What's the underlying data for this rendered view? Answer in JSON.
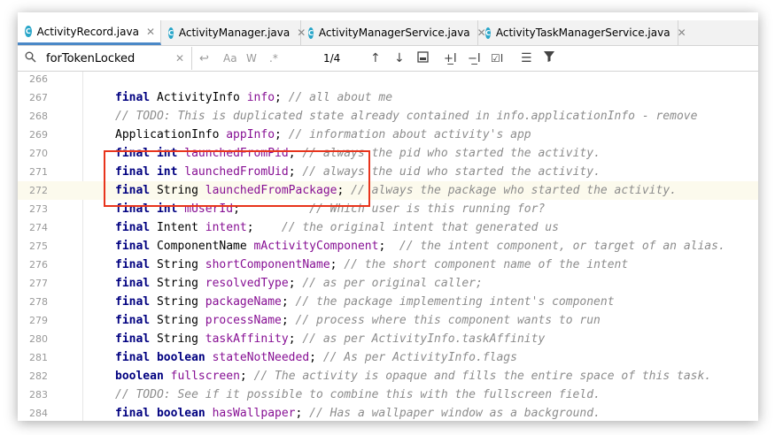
{
  "tabs": [
    {
      "label": "ActivityRecord.java",
      "active": true
    },
    {
      "label": "ActivityManager.java",
      "active": false
    },
    {
      "label": "ActivityManagerService.java",
      "active": false
    },
    {
      "label": "ActivityTaskManagerService.java",
      "active": false
    }
  ],
  "search": {
    "query": "forTokenLocked",
    "match_count": "1/4",
    "case_label": "Aa",
    "words_label": "W",
    "regex_label": ".*"
  },
  "editor": {
    "current_line": "272",
    "lines": [
      {
        "n": "266",
        "segs": []
      },
      {
        "n": "267",
        "segs": [
          [
            "kw",
            "final "
          ],
          [
            "t",
            "ActivityInfo "
          ],
          [
            "fld",
            "info"
          ],
          [
            "t",
            "; "
          ],
          [
            "cmt",
            "// all about me"
          ]
        ]
      },
      {
        "n": "268",
        "segs": [
          [
            "cmt",
            "// TODO: This is duplicated state already contained in info.applicationInfo - remove"
          ]
        ]
      },
      {
        "n": "269",
        "segs": [
          [
            "t",
            "ApplicationInfo "
          ],
          [
            "fld",
            "appInfo"
          ],
          [
            "t",
            "; "
          ],
          [
            "cmt",
            "// information about activity's app"
          ]
        ]
      },
      {
        "n": "270",
        "segs": [
          [
            "kw",
            "final int "
          ],
          [
            "fld",
            "launchedFromPid"
          ],
          [
            "t",
            "; "
          ],
          [
            "cmt",
            "// always the pid who started the activity."
          ]
        ]
      },
      {
        "n": "271",
        "segs": [
          [
            "kw",
            "final int "
          ],
          [
            "fld",
            "launchedFromUid"
          ],
          [
            "t",
            "; "
          ],
          [
            "cmt",
            "// always the uid who started the activity."
          ]
        ]
      },
      {
        "n": "272",
        "segs": [
          [
            "kw",
            "final "
          ],
          [
            "t",
            "String "
          ],
          [
            "fld",
            "launchedFromPackage"
          ],
          [
            "t",
            "; "
          ],
          [
            "cmt",
            "// always the package who started the activity."
          ]
        ]
      },
      {
        "n": "273",
        "segs": [
          [
            "kw",
            "final int "
          ],
          [
            "fld",
            "mUserId"
          ],
          [
            "t",
            ";          "
          ],
          [
            "cmt",
            "// Which user is this running for?"
          ]
        ]
      },
      {
        "n": "274",
        "segs": [
          [
            "kw",
            "final "
          ],
          [
            "t",
            "Intent "
          ],
          [
            "fld",
            "intent"
          ],
          [
            "t",
            ";    "
          ],
          [
            "cmt",
            "// the original intent that generated us"
          ]
        ]
      },
      {
        "n": "275",
        "segs": [
          [
            "kw",
            "final "
          ],
          [
            "t",
            "ComponentName "
          ],
          [
            "fld",
            "mActivityComponent"
          ],
          [
            "t",
            ";  "
          ],
          [
            "cmt",
            "// the intent component, or target of an alias."
          ]
        ]
      },
      {
        "n": "276",
        "segs": [
          [
            "kw",
            "final "
          ],
          [
            "t",
            "String "
          ],
          [
            "fld",
            "shortComponentName"
          ],
          [
            "t",
            "; "
          ],
          [
            "cmt",
            "// the short component name of the intent"
          ]
        ]
      },
      {
        "n": "277",
        "segs": [
          [
            "kw",
            "final "
          ],
          [
            "t",
            "String "
          ],
          [
            "fld",
            "resolvedType"
          ],
          [
            "t",
            "; "
          ],
          [
            "cmt",
            "// as per original caller;"
          ]
        ]
      },
      {
        "n": "278",
        "segs": [
          [
            "kw",
            "final "
          ],
          [
            "t",
            "String "
          ],
          [
            "fld",
            "packageName"
          ],
          [
            "t",
            "; "
          ],
          [
            "cmt",
            "// the package implementing intent's component"
          ]
        ]
      },
      {
        "n": "279",
        "segs": [
          [
            "kw",
            "final "
          ],
          [
            "t",
            "String "
          ],
          [
            "fld",
            "processName"
          ],
          [
            "t",
            "; "
          ],
          [
            "cmt",
            "// process where this component wants to run"
          ]
        ]
      },
      {
        "n": "280",
        "segs": [
          [
            "kw",
            "final "
          ],
          [
            "t",
            "String "
          ],
          [
            "fld",
            "taskAffinity"
          ],
          [
            "t",
            "; "
          ],
          [
            "cmt",
            "// as per ActivityInfo.taskAffinity"
          ]
        ]
      },
      {
        "n": "281",
        "segs": [
          [
            "kw",
            "final boolean "
          ],
          [
            "fld",
            "stateNotNeeded"
          ],
          [
            "t",
            "; "
          ],
          [
            "cmt",
            "// As per ActivityInfo.flags"
          ]
        ]
      },
      {
        "n": "282",
        "segs": [
          [
            "kw",
            "boolean "
          ],
          [
            "fld",
            "fullscreen"
          ],
          [
            "t",
            "; "
          ],
          [
            "cmt",
            "// The activity is opaque and fills the entire space of this task."
          ]
        ]
      },
      {
        "n": "283",
        "segs": [
          [
            "cmt",
            "// TODO: See if it possible to combine this with the fullscreen field."
          ]
        ]
      },
      {
        "n": "284",
        "segs": [
          [
            "kw",
            "final boolean "
          ],
          [
            "fld",
            "hasWallpaper"
          ],
          [
            "t",
            "; "
          ],
          [
            "cmt",
            "// Has a wallpaper window as a background."
          ]
        ]
      }
    ]
  },
  "colors": {
    "keyword": "#000080",
    "field": "#871094",
    "comment": "#8c8c8c",
    "highlight_box": "#e8341c",
    "current_line": "#fcfaed"
  }
}
